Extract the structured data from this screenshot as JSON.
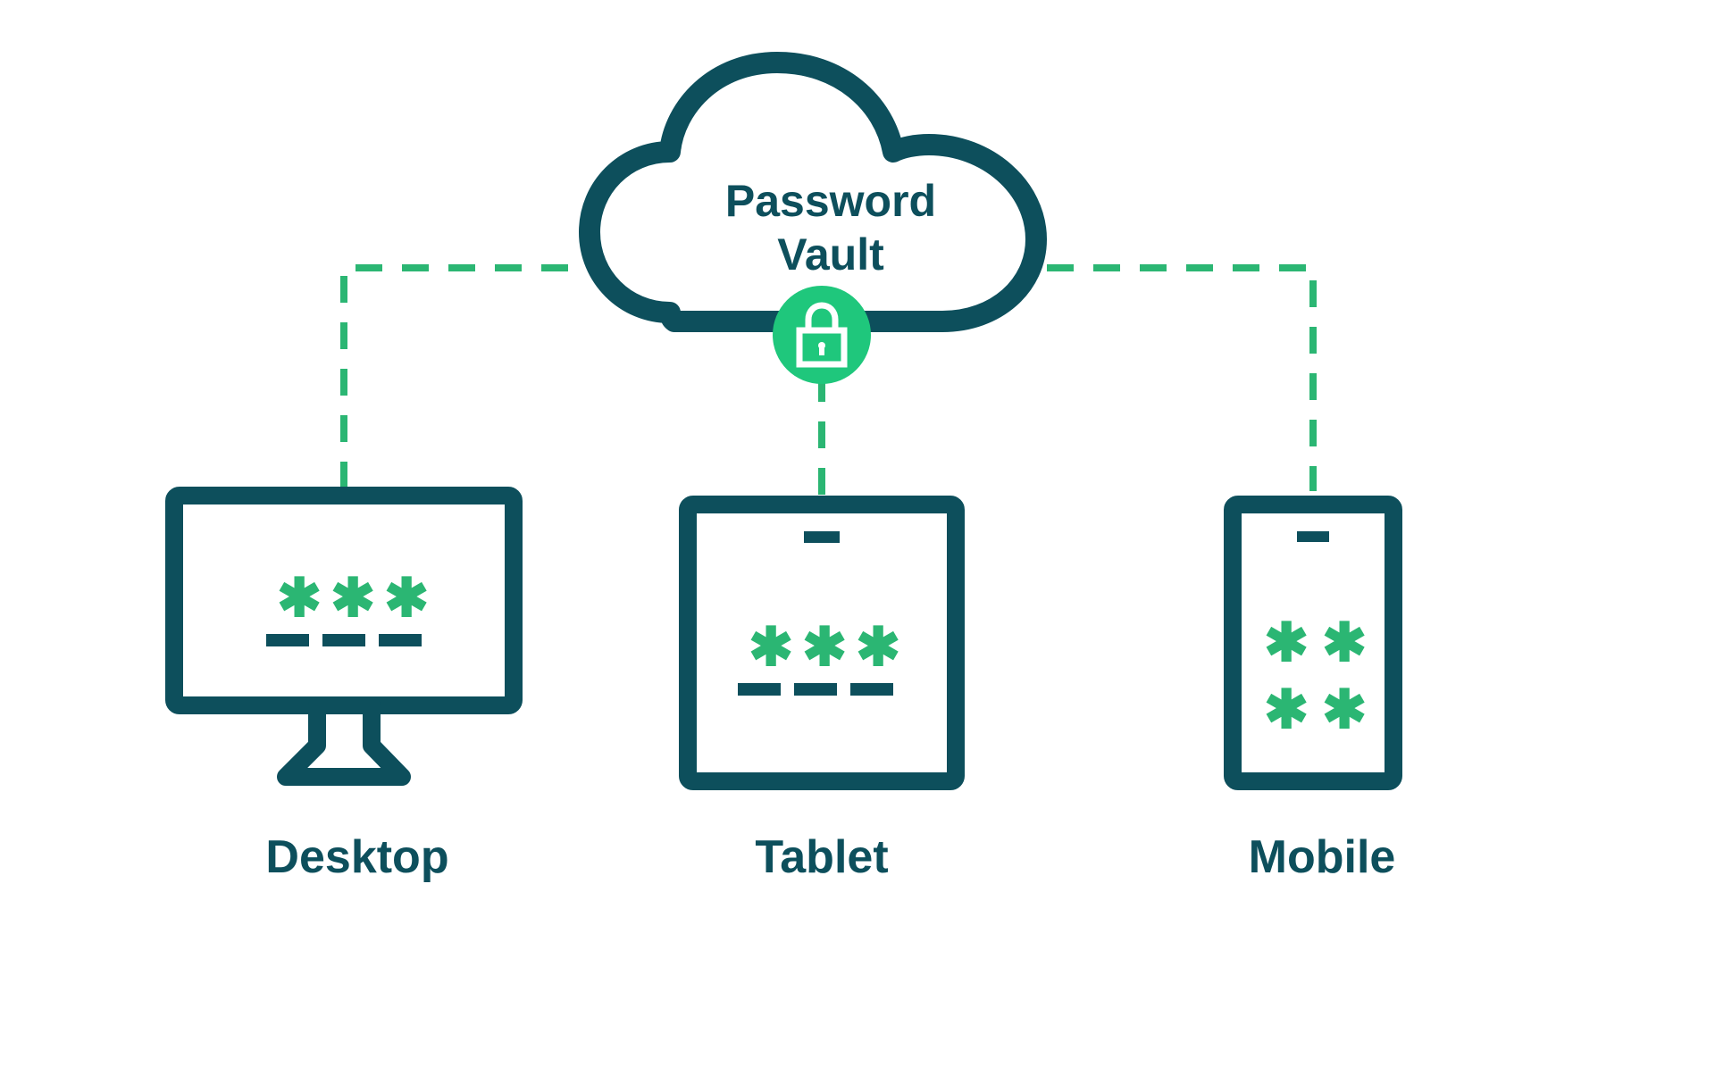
{
  "cloud": {
    "label_line1": "Password",
    "label_line2": "Vault"
  },
  "devices": {
    "desktop": {
      "label": "Desktop"
    },
    "tablet": {
      "label": "Tablet"
    },
    "mobile": {
      "label": "Mobile"
    }
  },
  "colors": {
    "dark_teal": "#0d4f5c",
    "green": "#2bb673",
    "green_bright": "#1fc77c"
  }
}
